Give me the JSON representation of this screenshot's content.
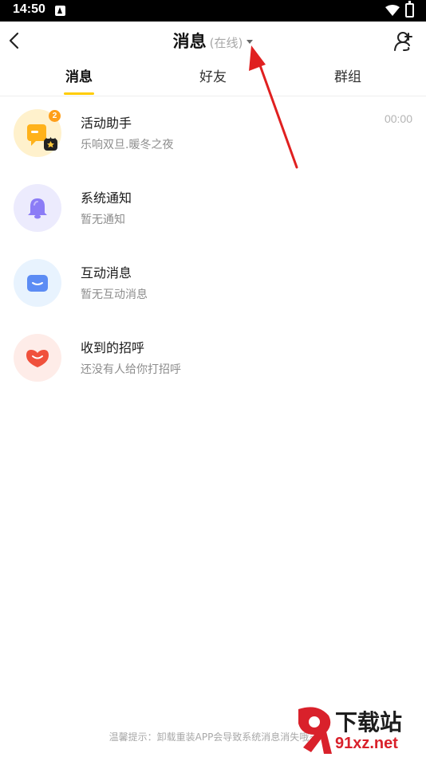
{
  "status_bar": {
    "time": "14:50"
  },
  "header": {
    "title": "消息",
    "online_status": "(在线)"
  },
  "tabs": [
    {
      "label": "消息",
      "active": true
    },
    {
      "label": "好友",
      "active": false
    },
    {
      "label": "群组",
      "active": false
    }
  ],
  "messages": [
    {
      "title": "活动助手",
      "subtitle": "乐响双旦.暖冬之夜",
      "time": "00:00",
      "badge": "2",
      "icon": "activity-assistant-icon"
    },
    {
      "title": "系统通知",
      "subtitle": "暂无通知",
      "icon": "bell-icon"
    },
    {
      "title": "互动消息",
      "subtitle": "暂无互动消息",
      "icon": "message-icon"
    },
    {
      "title": "收到的招呼",
      "subtitle": "还没有人给你打招呼",
      "icon": "greeting-icon"
    }
  ],
  "footer": {
    "tip": "温馨提示：卸载重装APP会导致系统消息消失哦~"
  },
  "watermark": {
    "brand": "下载站",
    "domain": "91xz.net"
  },
  "colors": {
    "accent": "#ffcc00",
    "badge": "#ff9f1a",
    "annotation": "#e02020"
  }
}
